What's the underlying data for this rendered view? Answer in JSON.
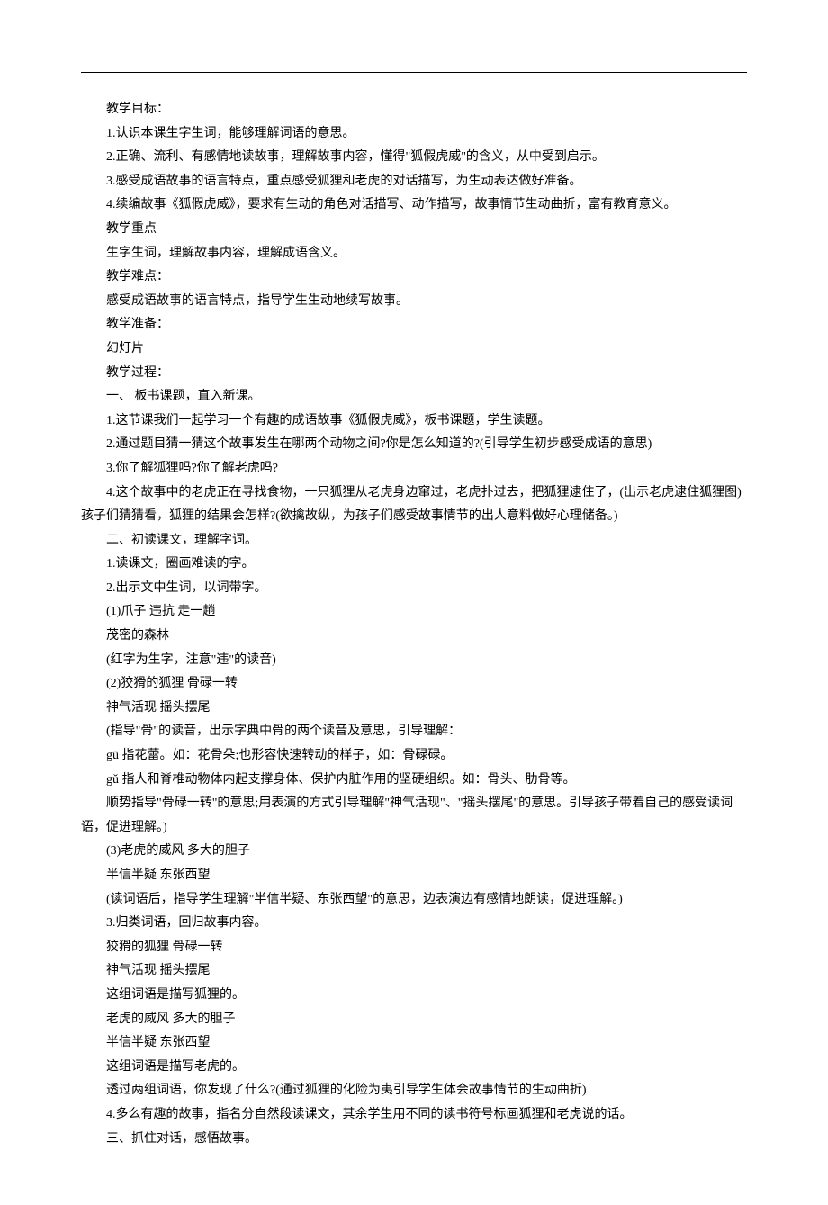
{
  "lines": [
    "教学目标：",
    "1.认识本课生字生词，能够理解词语的意思。",
    "2.正确、流利、有感情地读故事，理解故事内容，懂得\"狐假虎威\"的含义，从中受到启示。",
    "3.感受成语故事的语言特点，重点感受狐狸和老虎的对话描写，为生动表达做好准备。",
    "4.续编故事《狐假虎威》，要求有生动的角色对话描写、动作描写，故事情节生动曲折，富有教育意义。",
    "教学重点",
    "生字生词，理解故事内容，理解成语含义。",
    "教学难点：",
    "感受成语故事的语言特点，指导学生生动地续写故事。",
    "教学准备：",
    "幻灯片",
    "教学过程：",
    "一、  板书课题，直入新课。",
    "1.这节课我们一起学习一个有趣的成语故事《狐假虎威》，板书课题，学生读题。",
    "2.通过题目猜一猜这个故事发生在哪两个动物之间?你是怎么知道的?(引导学生初步感受成语的意思)",
    "3.你了解狐狸吗?你了解老虎吗?",
    "4.这个故事中的老虎正在寻找食物，一只狐狸从老虎身边窜过，老虎扑过去，把狐狸逮住了，(出示老虎逮住狐狸图)孩子们猜猜看，狐狸的结果会怎样?(欲擒故纵，为孩子们感受故事情节的出人意料做好心理储备。)",
    "二、初读课文，理解字词。",
    "1.读课文，圈画难读的字。",
    "2.出示文中生词，以词带字。",
    "(1)爪子  违抗  走一趟",
    "茂密的森林",
    "(红字为生字，注意\"违\"的读音)",
    "(2)狡猾的狐狸  骨碌一转",
    "神气活现  摇头摆尾",
    "(指导\"骨\"的读音，出示字典中骨的两个读音及意思，引导理解：",
    "gū 指花蕾。如：花骨朵;也形容快速转动的样子，如：骨碌碌。",
    "gǔ 指人和脊椎动物体内起支撑身体、保护内脏作用的坚硬组织。如：骨头、肋骨等。",
    "顺势指导\"骨碌一转\"的意思;用表演的方式引导理解\"神气活现\"、\"摇头摆尾\"的意思。引导孩子带着自己的感受读词语，促进理解。)",
    "(3)老虎的威风  多大的胆子",
    "半信半疑  东张西望",
    "(读词语后，指导学生理解\"半信半疑、东张西望\"的意思，边表演边有感情地朗读，促进理解。)",
    "3.归类词语，回归故事内容。",
    "狡猾的狐狸  骨碌一转",
    "神气活现  摇头摆尾",
    "这组词语是描写狐狸的。",
    "老虎的威风  多大的胆子",
    "半信半疑  东张西望",
    "这组词语是描写老虎的。",
    "透过两组词语，你发现了什么?(通过狐狸的化险为夷引导学生体会故事情节的生动曲折)",
    "4.多么有趣的故事，指名分自然段读课文，其余学生用不同的读书符号标画狐狸和老虎说的话。",
    "三、抓住对话，感悟故事。"
  ]
}
